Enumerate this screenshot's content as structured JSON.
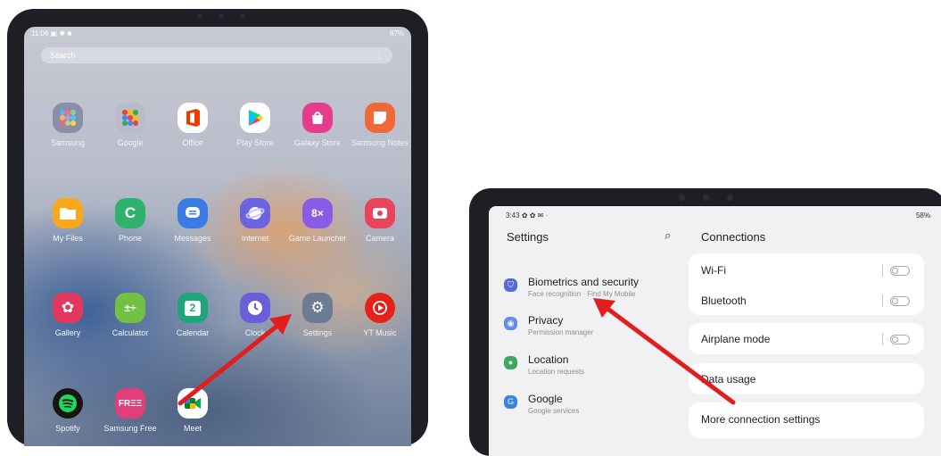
{
  "left_tablet": {
    "status": {
      "time": "11:06",
      "right": "87%"
    },
    "search": {
      "placeholder": "Search",
      "menu": "⋮"
    },
    "apps": [
      {
        "label": "Samsung",
        "icon": "samsung-folder-icon",
        "color": "#8a8fa8"
      },
      {
        "label": "Google",
        "icon": "google-folder-icon",
        "color": "#a9adba"
      },
      {
        "label": "Office",
        "icon": "office-icon",
        "color": "#ffffff"
      },
      {
        "label": "Play Store",
        "icon": "play-store-icon",
        "color": "#ffffff"
      },
      {
        "label": "Galaxy Store",
        "icon": "galaxy-store-icon",
        "color": "#e63c8c"
      },
      {
        "label": "Samsung Notes",
        "icon": "samsung-notes-icon",
        "color": "#f0683a"
      },
      {
        "label": "My Files",
        "icon": "folder-icon",
        "color": "#f7a81b"
      },
      {
        "label": "Phone",
        "icon": "phone-icon",
        "color": "#2fb36c"
      },
      {
        "label": "Messages",
        "icon": "messages-icon",
        "color": "#3c7be3"
      },
      {
        "label": "Internet",
        "icon": "internet-icon",
        "color": "#6b64e0"
      },
      {
        "label": "Game Launcher",
        "icon": "game-launcher-icon",
        "color": "#8a5ce6"
      },
      {
        "label": "Camera",
        "icon": "camera-icon",
        "color": "#e8445a"
      },
      {
        "label": "Gallery",
        "icon": "gallery-icon",
        "color": "#e2385e"
      },
      {
        "label": "Calculator",
        "icon": "calculator-icon",
        "color": "#74c043"
      },
      {
        "label": "Calendar",
        "icon": "calendar-icon",
        "color": "#1fa57a"
      },
      {
        "label": "Clock",
        "icon": "clock-icon",
        "color": "#6b5fd9"
      },
      {
        "label": "Settings",
        "icon": "gear-icon",
        "color": "#6d7c92"
      },
      {
        "label": "YT Music",
        "icon": "yt-music-icon",
        "color": "#e62117"
      },
      {
        "label": "Spotify",
        "icon": "spotify-icon",
        "color": "#191414"
      },
      {
        "label": "Samsung Free",
        "icon": "samsung-free-icon",
        "color": "#e23e7a"
      },
      {
        "label": "Meet",
        "icon": "meet-icon",
        "color": "#ffffff"
      }
    ],
    "calendar_day": "2",
    "free_text": "FRΞΞ"
  },
  "right_tablet": {
    "status": {
      "time": "3:43",
      "right": "58%"
    },
    "settings_title": "Settings",
    "search_glyph": "⌕",
    "items": [
      {
        "title": "Biometrics and security",
        "subtitle": "Face recognition · Find My Mobile",
        "color": "#5869d8",
        "icon": "shield-icon"
      },
      {
        "title": "Privacy",
        "subtitle": "Permission manager",
        "color": "#5d8fe3",
        "icon": "privacy-icon"
      },
      {
        "title": "Location",
        "subtitle": "Location requests",
        "color": "#3caa5b",
        "icon": "location-icon"
      },
      {
        "title": "Google",
        "subtitle": "Google services",
        "color": "#3b82e6",
        "icon": "google-icon"
      }
    ],
    "connections_title": "Connections",
    "rows": {
      "wifi": "Wi-Fi",
      "bluetooth": "Bluetooth",
      "airplane": "Airplane mode",
      "data": "Data usage",
      "more": "More connection settings"
    }
  },
  "annotation": {
    "arrow_color": "#e11d1d"
  }
}
